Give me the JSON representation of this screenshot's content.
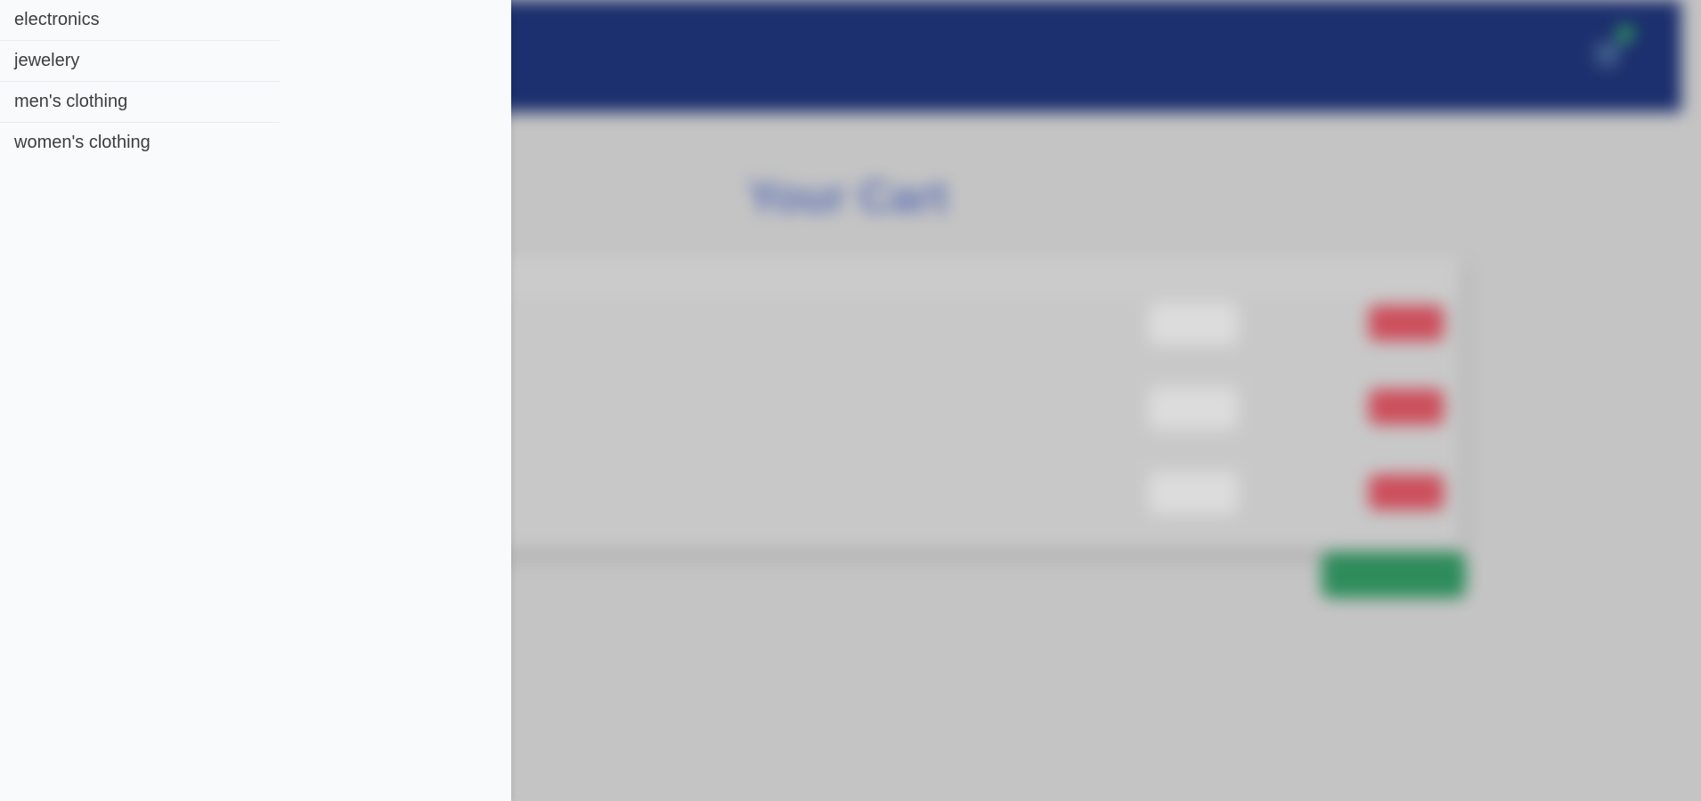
{
  "sidebar": {
    "categories": [
      {
        "label": "electronics"
      },
      {
        "label": "jewelery"
      },
      {
        "label": "men's clothing"
      },
      {
        "label": "women's clothing"
      }
    ]
  },
  "background": {
    "page_title": "Your Cart",
    "colors": {
      "header": "#1c2f6e",
      "remove_button": "#cc4f5c",
      "checkout_button": "#2e8c5b",
      "overlay": "#c4c4c4"
    }
  }
}
